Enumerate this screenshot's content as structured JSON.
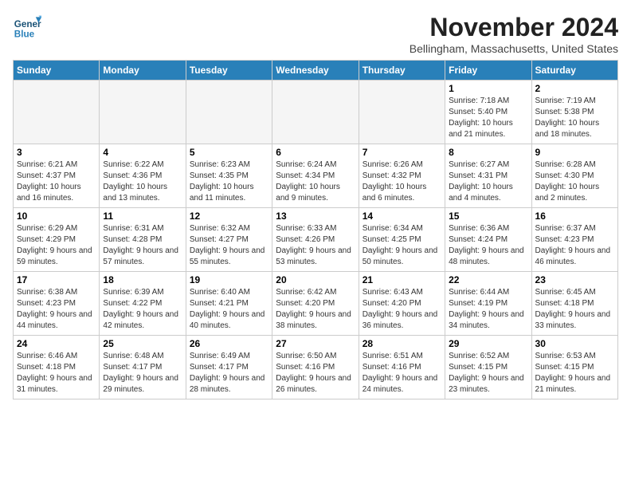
{
  "logo": {
    "line1": "General",
    "line2": "Blue"
  },
  "title": "November 2024",
  "subtitle": "Bellingham, Massachusetts, United States",
  "weekdays": [
    "Sunday",
    "Monday",
    "Tuesday",
    "Wednesday",
    "Thursday",
    "Friday",
    "Saturday"
  ],
  "weeks": [
    [
      {
        "day": "",
        "empty": true
      },
      {
        "day": "",
        "empty": true
      },
      {
        "day": "",
        "empty": true
      },
      {
        "day": "",
        "empty": true
      },
      {
        "day": "",
        "empty": true
      },
      {
        "day": "1",
        "sunrise": "Sunrise: 7:18 AM",
        "sunset": "Sunset: 5:40 PM",
        "daylight": "Daylight: 10 hours and 21 minutes."
      },
      {
        "day": "2",
        "sunrise": "Sunrise: 7:19 AM",
        "sunset": "Sunset: 5:38 PM",
        "daylight": "Daylight: 10 hours and 18 minutes."
      }
    ],
    [
      {
        "day": "3",
        "sunrise": "Sunrise: 6:21 AM",
        "sunset": "Sunset: 4:37 PM",
        "daylight": "Daylight: 10 hours and 16 minutes."
      },
      {
        "day": "4",
        "sunrise": "Sunrise: 6:22 AM",
        "sunset": "Sunset: 4:36 PM",
        "daylight": "Daylight: 10 hours and 13 minutes."
      },
      {
        "day": "5",
        "sunrise": "Sunrise: 6:23 AM",
        "sunset": "Sunset: 4:35 PM",
        "daylight": "Daylight: 10 hours and 11 minutes."
      },
      {
        "day": "6",
        "sunrise": "Sunrise: 6:24 AM",
        "sunset": "Sunset: 4:34 PM",
        "daylight": "Daylight: 10 hours and 9 minutes."
      },
      {
        "day": "7",
        "sunrise": "Sunrise: 6:26 AM",
        "sunset": "Sunset: 4:32 PM",
        "daylight": "Daylight: 10 hours and 6 minutes."
      },
      {
        "day": "8",
        "sunrise": "Sunrise: 6:27 AM",
        "sunset": "Sunset: 4:31 PM",
        "daylight": "Daylight: 10 hours and 4 minutes."
      },
      {
        "day": "9",
        "sunrise": "Sunrise: 6:28 AM",
        "sunset": "Sunset: 4:30 PM",
        "daylight": "Daylight: 10 hours and 2 minutes."
      }
    ],
    [
      {
        "day": "10",
        "sunrise": "Sunrise: 6:29 AM",
        "sunset": "Sunset: 4:29 PM",
        "daylight": "Daylight: 9 hours and 59 minutes."
      },
      {
        "day": "11",
        "sunrise": "Sunrise: 6:31 AM",
        "sunset": "Sunset: 4:28 PM",
        "daylight": "Daylight: 9 hours and 57 minutes."
      },
      {
        "day": "12",
        "sunrise": "Sunrise: 6:32 AM",
        "sunset": "Sunset: 4:27 PM",
        "daylight": "Daylight: 9 hours and 55 minutes."
      },
      {
        "day": "13",
        "sunrise": "Sunrise: 6:33 AM",
        "sunset": "Sunset: 4:26 PM",
        "daylight": "Daylight: 9 hours and 53 minutes."
      },
      {
        "day": "14",
        "sunrise": "Sunrise: 6:34 AM",
        "sunset": "Sunset: 4:25 PM",
        "daylight": "Daylight: 9 hours and 50 minutes."
      },
      {
        "day": "15",
        "sunrise": "Sunrise: 6:36 AM",
        "sunset": "Sunset: 4:24 PM",
        "daylight": "Daylight: 9 hours and 48 minutes."
      },
      {
        "day": "16",
        "sunrise": "Sunrise: 6:37 AM",
        "sunset": "Sunset: 4:23 PM",
        "daylight": "Daylight: 9 hours and 46 minutes."
      }
    ],
    [
      {
        "day": "17",
        "sunrise": "Sunrise: 6:38 AM",
        "sunset": "Sunset: 4:23 PM",
        "daylight": "Daylight: 9 hours and 44 minutes."
      },
      {
        "day": "18",
        "sunrise": "Sunrise: 6:39 AM",
        "sunset": "Sunset: 4:22 PM",
        "daylight": "Daylight: 9 hours and 42 minutes."
      },
      {
        "day": "19",
        "sunrise": "Sunrise: 6:40 AM",
        "sunset": "Sunset: 4:21 PM",
        "daylight": "Daylight: 9 hours and 40 minutes."
      },
      {
        "day": "20",
        "sunrise": "Sunrise: 6:42 AM",
        "sunset": "Sunset: 4:20 PM",
        "daylight": "Daylight: 9 hours and 38 minutes."
      },
      {
        "day": "21",
        "sunrise": "Sunrise: 6:43 AM",
        "sunset": "Sunset: 4:20 PM",
        "daylight": "Daylight: 9 hours and 36 minutes."
      },
      {
        "day": "22",
        "sunrise": "Sunrise: 6:44 AM",
        "sunset": "Sunset: 4:19 PM",
        "daylight": "Daylight: 9 hours and 34 minutes."
      },
      {
        "day": "23",
        "sunrise": "Sunrise: 6:45 AM",
        "sunset": "Sunset: 4:18 PM",
        "daylight": "Daylight: 9 hours and 33 minutes."
      }
    ],
    [
      {
        "day": "24",
        "sunrise": "Sunrise: 6:46 AM",
        "sunset": "Sunset: 4:18 PM",
        "daylight": "Daylight: 9 hours and 31 minutes."
      },
      {
        "day": "25",
        "sunrise": "Sunrise: 6:48 AM",
        "sunset": "Sunset: 4:17 PM",
        "daylight": "Daylight: 9 hours and 29 minutes."
      },
      {
        "day": "26",
        "sunrise": "Sunrise: 6:49 AM",
        "sunset": "Sunset: 4:17 PM",
        "daylight": "Daylight: 9 hours and 28 minutes."
      },
      {
        "day": "27",
        "sunrise": "Sunrise: 6:50 AM",
        "sunset": "Sunset: 4:16 PM",
        "daylight": "Daylight: 9 hours and 26 minutes."
      },
      {
        "day": "28",
        "sunrise": "Sunrise: 6:51 AM",
        "sunset": "Sunset: 4:16 PM",
        "daylight": "Daylight: 9 hours and 24 minutes."
      },
      {
        "day": "29",
        "sunrise": "Sunrise: 6:52 AM",
        "sunset": "Sunset: 4:15 PM",
        "daylight": "Daylight: 9 hours and 23 minutes."
      },
      {
        "day": "30",
        "sunrise": "Sunrise: 6:53 AM",
        "sunset": "Sunset: 4:15 PM",
        "daylight": "Daylight: 9 hours and 21 minutes."
      }
    ]
  ]
}
